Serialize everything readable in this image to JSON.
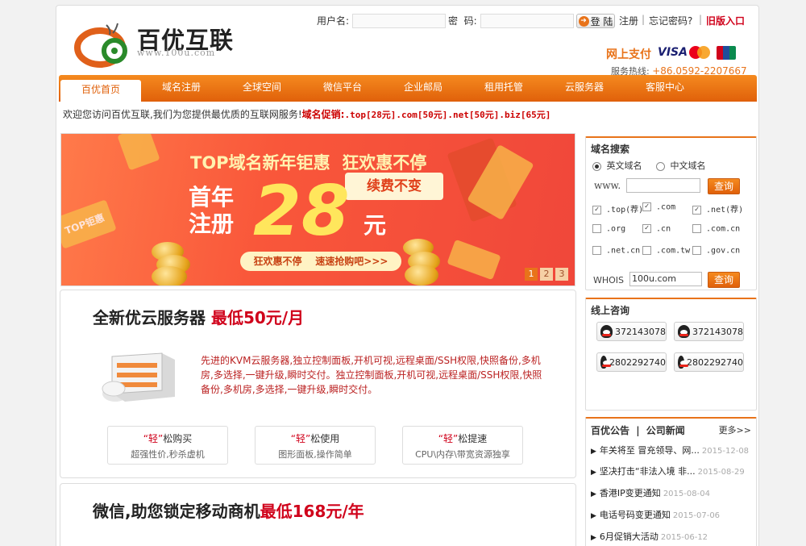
{
  "header": {
    "logo_name": "百优互联",
    "logo_url": "www.100u.com",
    "username_label": "用户名:",
    "password_label": "密  码:",
    "login_button": "登 陆",
    "register_link": "注册",
    "forgot_link": "忘记密码?",
    "old_entry_link": "旧版入口",
    "pay_label": "网上支付",
    "visa": "VISA",
    "hotline_label": "服务热线:",
    "hotline_number": "+86.0592-2207667"
  },
  "nav": {
    "items": [
      "百优首页",
      "域名注册",
      "全球空间",
      "微信平台",
      "企业邮局",
      "租用托管",
      "云服务器",
      "客服中心"
    ]
  },
  "welcome": {
    "text": "欢迎您访问百优互联,我们为您提供最优质的互联网服务!",
    "promo_label": "域名促销:",
    "promo": ".top[28元].com[50元].net[50元].biz[65元]"
  },
  "banner": {
    "line1": "TOP域名新年钜惠  狂欢惠不停",
    "ribbon": "续费不变",
    "first_a": "首年",
    "first_b": "注册",
    "price": "28",
    "unit": "元",
    "cta": "狂欢惠不停    速速抢购吧>>>",
    "ticket": "TOP钜惠",
    "pages": [
      "1",
      "2",
      "3"
    ]
  },
  "cloud": {
    "title": "全新优云服务器",
    "title_price": "最低50元/月",
    "desc": "先进的KVM云服务器,独立控制面板,开机可视,远程桌面/SSH权限,快照备份,多机房,多选择,一键升级,瞬时交付。独立控制面板,开机可视,远程桌面/SSH权限,快照备份,多机房,多选择,一键升级,瞬时交付。",
    "features": [
      {
        "hl": "“轻”",
        "rest": "松购买",
        "sub": "超强性价,秒杀虚机"
      },
      {
        "hl": "“轻”",
        "rest": "松使用",
        "sub": "图形面板,操作简单"
      },
      {
        "hl": "“轻”",
        "rest": "松提速",
        "sub": "CPU\\内存\\带宽资源独享"
      }
    ]
  },
  "weixin": {
    "title": "微信,助您锁定移动商机",
    "title_price": "最低168元/年"
  },
  "domain_search": {
    "title": "域名搜索",
    "radio_en": "英文域名",
    "radio_cn": "中文域名",
    "www_label": "www.",
    "query_button": "查询",
    "tlds": [
      {
        "label": ".top(荐)",
        "checked": true
      },
      {
        "label": ".com",
        "checked": true
      },
      {
        "label": ".net(荐)",
        "checked": true
      },
      {
        "label": ".org",
        "checked": false
      },
      {
        "label": ".cn",
        "checked": true
      },
      {
        "label": ".com.cn",
        "checked": false
      },
      {
        "label": ".net.cn",
        "checked": false
      },
      {
        "label": ".com.tw",
        "checked": false
      },
      {
        "label": ".gov.cn",
        "checked": false
      }
    ],
    "whois_label": "WHOIS",
    "whois_value": "100u.com",
    "whois_button": "查询"
  },
  "online": {
    "title": "线上咨询",
    "qq": [
      "372143078",
      "372143078",
      "2802292740",
      "2802292740"
    ]
  },
  "news": {
    "tab1": "百优公告",
    "tab2": "公司新闻",
    "more": "更多>>",
    "items": [
      {
        "title": "年关将至 冒充领导、网...",
        "date": "2015-12-08"
      },
      {
        "title": "坚决打击“非法入境 非...",
        "date": "2015-08-29"
      },
      {
        "title": "香港IP变更通知",
        "date": "2015-08-04"
      },
      {
        "title": "电话号码变更通知",
        "date": "2015-07-06"
      },
      {
        "title": "6月促销大活动",
        "date": "2015-06-12"
      }
    ]
  },
  "colors": {
    "accent": "#e8731a",
    "red": "#d0021b"
  }
}
